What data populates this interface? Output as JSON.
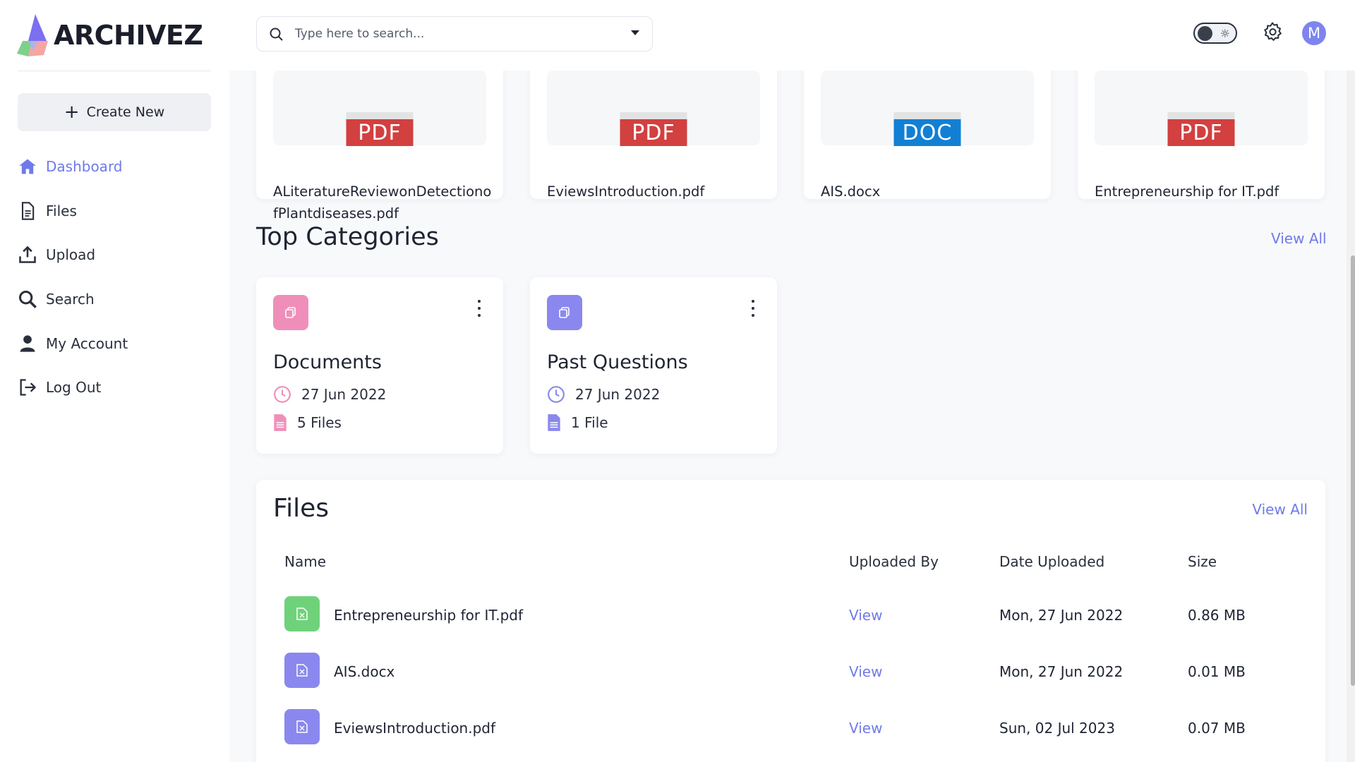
{
  "app": {
    "name": "ARCHIVEZ"
  },
  "sidebar": {
    "create_label": "Create New",
    "items": [
      {
        "label": "Dashboard",
        "icon": "home-icon",
        "active": true
      },
      {
        "label": "Files",
        "icon": "file-icon"
      },
      {
        "label": "Upload",
        "icon": "upload-icon"
      },
      {
        "label": "Search",
        "icon": "search-icon"
      },
      {
        "label": "My Account",
        "icon": "user-icon"
      },
      {
        "label": "Log Out",
        "icon": "logout-icon"
      }
    ]
  },
  "topbar": {
    "search_placeholder": "Type here to search...",
    "avatar_initial": "M",
    "theme_icon": "sun-icon"
  },
  "recent_files": [
    {
      "type": "PDF",
      "name": "ALiteratureReviewonDetectionofPlantdiseases.pdf"
    },
    {
      "type": "PDF",
      "name": "EviewsIntroduction.pdf"
    },
    {
      "type": "DOC",
      "name": "AIS.docx"
    },
    {
      "type": "PDF",
      "name": "Entrepreneurship for IT.pdf"
    }
  ],
  "categories_section": {
    "title": "Top Categories",
    "view_all": "View All"
  },
  "categories": [
    {
      "title": "Documents",
      "date": "27 Jun 2022",
      "files": "5 Files",
      "color": "#ef8fb9"
    },
    {
      "title": "Past Questions",
      "date": "27 Jun 2022",
      "files": "1 File",
      "color": "#8a88ee"
    }
  ],
  "files_section": {
    "title": "Files",
    "view_all": "View All",
    "columns": [
      "Name",
      "Uploaded By",
      "Date Uploaded",
      "Size"
    ],
    "rows": [
      {
        "name": "Entrepreneurship for IT.pdf",
        "uploaded_by": "View",
        "date": "Mon, 27 Jun 2022",
        "size": "0.86 MB",
        "color": "#6fd27b"
      },
      {
        "name": "AIS.docx",
        "uploaded_by": "View",
        "date": "Mon, 27 Jun 2022",
        "size": "0.01 MB",
        "color": "#8a88ee"
      },
      {
        "name": "EviewsIntroduction.pdf",
        "uploaded_by": "View",
        "date": "Sun, 02 Jul 2023",
        "size": "0.07 MB",
        "color": "#8a88ee"
      }
    ]
  },
  "colors": {
    "accent": "#6f7aea",
    "pdf": "#d24040",
    "doc": "#1180d4"
  }
}
